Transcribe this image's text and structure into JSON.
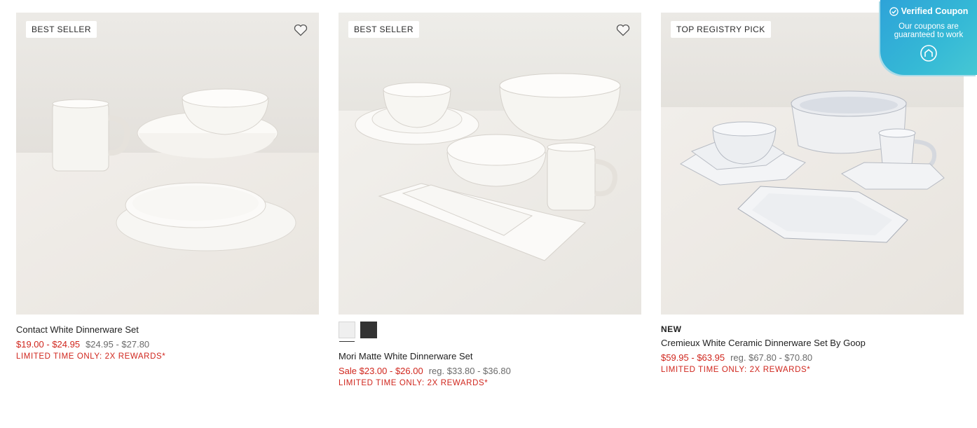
{
  "products": [
    {
      "badge": "BEST SELLER",
      "name": "Contact White Dinnerware Set",
      "price_sale": "$19.00 - $24.95",
      "price_reg": "$24.95 - $27.80",
      "promo": "LIMITED TIME ONLY: 2X REWARDS*",
      "favorite_icon": "heart-outline-icon"
    },
    {
      "badge": "BEST SELLER",
      "name": "Mori Matte White Dinnerware Set",
      "price_sale": "Sale $23.00 - $26.00",
      "price_reg": "reg. $33.80 - $36.80",
      "promo": "LIMITED TIME ONLY: 2X REWARDS*",
      "favorite_icon": "heart-outline-icon",
      "swatches": [
        {
          "color": "#efefef",
          "selected": true
        },
        {
          "color": "#333333",
          "selected": false
        }
      ]
    },
    {
      "badge": "TOP REGISTRY PICK",
      "tag": "NEW",
      "name": "Cremieux White Ceramic Dinnerware Set By Goop",
      "price_sale": "$59.95 - $63.95",
      "price_reg": "reg. $67.80 - $70.80",
      "promo": "LIMITED TIME ONLY: 2X REWARDS*",
      "favorite_icon": "heart-outline-icon"
    }
  ],
  "coupon": {
    "title": "Verified Coupon",
    "subtitle_line1": "Our coupons are",
    "subtitle_line2": "guaranteed to work",
    "icon": "coupon-logo-icon"
  },
  "colors": {
    "sale_red": "#d0261d",
    "reg_gray": "#6b6b6b",
    "coupon_blue": "#2ea3d8"
  }
}
